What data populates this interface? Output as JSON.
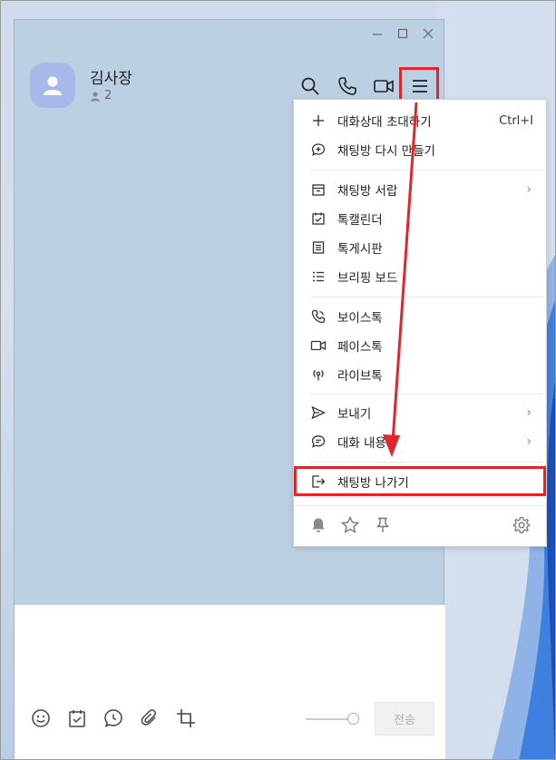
{
  "chat": {
    "title": "김사장",
    "member_count": "2"
  },
  "menu": {
    "items": [
      {
        "label": "대화상대 초대하기",
        "shortcut": "Ctrl+I"
      },
      {
        "label": "채팅방 다시 만들기"
      },
      {
        "label": "채팅방 서랍",
        "has_submenu": true
      },
      {
        "label": "톡캘린더"
      },
      {
        "label": "톡게시판"
      },
      {
        "label": "브리핑 보드"
      },
      {
        "label": "보이스톡"
      },
      {
        "label": "페이스톡"
      },
      {
        "label": "라이브톡"
      },
      {
        "label": "보내기",
        "has_submenu": true
      },
      {
        "label": "대화 내용",
        "has_submenu": true
      },
      {
        "label": "채팅방 나가기"
      }
    ],
    "submenu_chevron": "›"
  },
  "compose": {
    "send_label": "전송"
  },
  "colors": {
    "highlight": "#e0262b",
    "window_bg": "#bcd0e3",
    "avatar_bg": "#a7b9e8"
  }
}
